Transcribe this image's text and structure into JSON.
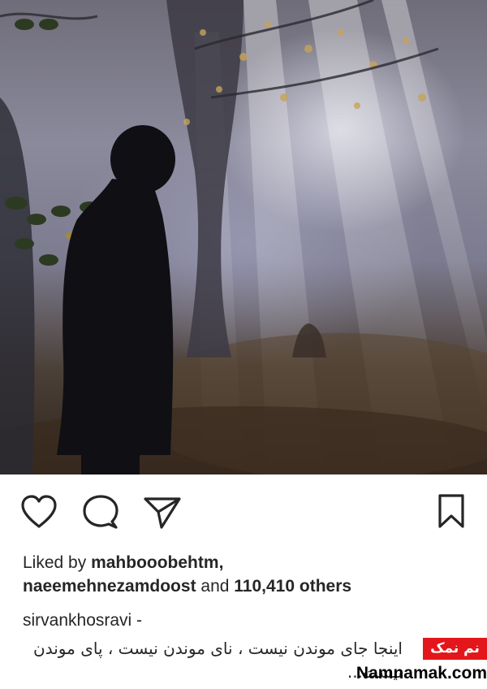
{
  "post": {
    "image_alt": "Silhouette of a man in a misty autumn forest"
  },
  "actions": {
    "like_icon": "heart-icon",
    "comment_icon": "comment-icon",
    "share_icon": "paper-plane-icon",
    "save_icon": "bookmark-icon"
  },
  "likes": {
    "prefix": "Liked by ",
    "user1": "mahbooobehtm",
    "separator": ",",
    "user2": "naeemehnezamdoost",
    "middle": " and ",
    "others": "110,410 others"
  },
  "caption": {
    "username": "sirvankhosravi",
    "dash": " -",
    "text": "اینجا جای موندن نیست ، نای موندن نیست ، پای موندن نیست..."
  },
  "watermark": {
    "badge": "نم نمک",
    "domain": "Namnamak.com"
  },
  "colors": {
    "text": "#262626",
    "watermark_red": "#e3171b"
  }
}
